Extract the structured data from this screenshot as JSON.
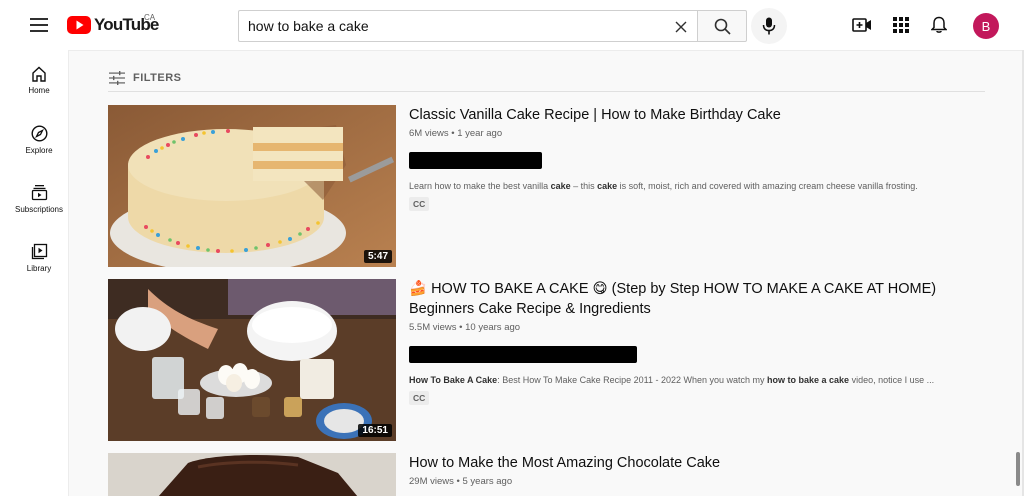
{
  "header": {
    "logo_text": "YouTube",
    "country_code": "CA",
    "search": {
      "value": "how to bake a cake",
      "placeholder": "Search"
    },
    "avatar_letter": "B",
    "icons": [
      "menu-icon",
      "clear-icon",
      "search-icon",
      "mic-icon",
      "create-video-icon",
      "apps-grid-icon",
      "notifications-bell-icon"
    ],
    "brand_red": "#ff0000",
    "avatar_color": "#c2185b"
  },
  "sidebar": {
    "items": [
      {
        "label": "Home",
        "icon": "home-icon"
      },
      {
        "label": "Explore",
        "icon": "compass-icon"
      },
      {
        "label": "Subscriptions",
        "icon": "subscriptions-icon"
      },
      {
        "label": "Library",
        "icon": "library-icon"
      }
    ]
  },
  "filters": {
    "label": "FILTERS",
    "icon": "filters-sliders-icon"
  },
  "results": [
    {
      "title": "Classic Vanilla Cake Recipe | How to Make Birthday Cake",
      "views": "6M views",
      "age": "1 year ago",
      "duration": "5:47",
      "desc_parts": [
        "Learn how to make the best vanilla ",
        "cake",
        " – this ",
        "cake",
        " is soft, moist, rich and covered with amazing cream cheese vanilla frosting."
      ],
      "badge": "CC"
    },
    {
      "title_line1": "🍰 HOW TO BAKE A CAKE 😋 (Step by Step HOW TO MAKE A CAKE AT HOME)",
      "title_line2": "Beginners Cake Recipe & Ingredients",
      "views": "5.5M views",
      "age": "10 years ago",
      "duration": "16:51",
      "desc_parts": [
        "How To Bake A Cake",
        ": Best How To Make Cake Recipe 2011 - 2022 When you watch my ",
        "how to bake a cake",
        " video, notice I use ..."
      ],
      "badge": "CC"
    },
    {
      "title": "How to Make the Most Amazing Chocolate Cake",
      "views": "29M views",
      "age": "5 years ago"
    }
  ],
  "meta_separator": "•"
}
